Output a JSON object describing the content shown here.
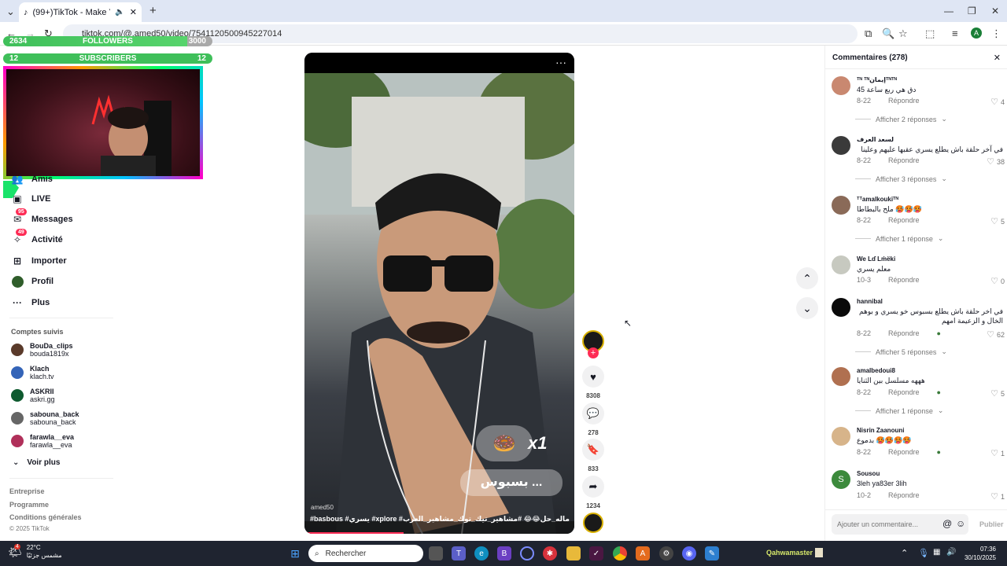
{
  "browser": {
    "tab_badge": "(99+)",
    "tab_title": "TikTok - Make Your Day",
    "url": "tiktok.com/@.amed50/video/7541120500945227014",
    "profile_initial": "A"
  },
  "overlay": {
    "followers_left": "2634",
    "followers_label": "FOLLOWERS",
    "followers_right": "3000",
    "subscribers_left": "12",
    "subscribers_label": "SUBSCRIBERS",
    "subscribers_right": "12"
  },
  "sidebar": {
    "items": [
      {
        "label": "Amis",
        "icon": "friends-icon"
      },
      {
        "label": "LIVE",
        "icon": "live-icon"
      },
      {
        "label": "Messages",
        "icon": "messages-icon",
        "badge": "95"
      },
      {
        "label": "Activité",
        "icon": "activity-icon",
        "badge": "49"
      },
      {
        "label": "Importer",
        "icon": "upload-icon"
      },
      {
        "label": "Profil",
        "icon": "profile-icon"
      },
      {
        "label": "Plus",
        "icon": "more-icon"
      }
    ],
    "following_title": "Comptes suivis",
    "following": [
      {
        "name": "BouDa_clips",
        "handle": "bouda1819x"
      },
      {
        "name": "Klach",
        "handle": "klach.tv"
      },
      {
        "name": "ASKRII",
        "handle": "askri.gg"
      },
      {
        "name": "sabouna_back",
        "handle": "sabouna_back"
      },
      {
        "name": "farawla__eva",
        "handle": "farawla__eva"
      }
    ],
    "see_more": "Voir plus",
    "footer": [
      "Entreprise",
      "Programme",
      "Conditions générales",
      "© 2025 TikTok"
    ]
  },
  "video": {
    "username_watermark": "amed50",
    "caption": "#basbous #يسري #xplore #شعب_الصيني_ماله_حل😂😂 #مشاهير_تيك_توك_مشاهير_العرب",
    "overlay_counter": "x1",
    "overlay_text": "بسبوس ..."
  },
  "actions": {
    "likes": "8308",
    "comments": "278",
    "saves": "833",
    "shares": "1234"
  },
  "comments": {
    "title": "Commentaires (278)",
    "reply_label": "Répondre",
    "input_placeholder": "Ajouter un commentaire...",
    "post_label": "Publier",
    "items": [
      {
        "user": "ᵀᴺ ᵀᴺإيمانᵀᴺᵀᴺ",
        "text": "دق هي ربع ساعة 45",
        "date": "8-22",
        "likes": "4",
        "more": "Afficher 2 réponses"
      },
      {
        "user": "لسعد العرف",
        "text": "في آخر حلقة باش يطلع يسري عقبها عليهم وعلينا",
        "date": "8-22",
        "likes": "38",
        "more": "Afficher 3 réponses"
      },
      {
        "user": "ᵀᵀamalkoukiᵀᴺ",
        "text": "ملح بالبطاطا 🥵🥵🥵",
        "date": "8-22",
        "likes": "5",
        "more": "Afficher 1 réponse"
      },
      {
        "user": "We Lɗ Lṁëki",
        "text": "معلم يسري",
        "date": "10-3",
        "likes": "0",
        "more": ""
      },
      {
        "user": "hannibal",
        "text": "في اخر حلقة باش يطلع بسبوس خو يسري و بوهم الخال و الزعيمة امهم",
        "date": "8-22",
        "likes": "62",
        "more": "Afficher 5 réponses"
      },
      {
        "user": "amalbedoui8",
        "text": "هههه مسلسل بين الثنايا",
        "date": "8-22",
        "likes": "5",
        "more": "Afficher 1 réponse"
      },
      {
        "user": "Nisrin Zaanouni",
        "text": "بدموع 🥵🥵🥵🥵",
        "date": "8-22",
        "likes": "1",
        "more": ""
      },
      {
        "user": "Sousou",
        "text": "3leh ya83er 3lih",
        "date": "10-2",
        "likes": "1",
        "more": "",
        "initial": "S"
      }
    ]
  },
  "taskbar": {
    "weather_temp": "22°C",
    "weather_desc": "مشمس جزئيًا",
    "weather_badge": "4",
    "search_placeholder": "Rechercher",
    "streamer_label": "Qahwamaster :",
    "time": "07:36",
    "date": "30/10/2025"
  }
}
